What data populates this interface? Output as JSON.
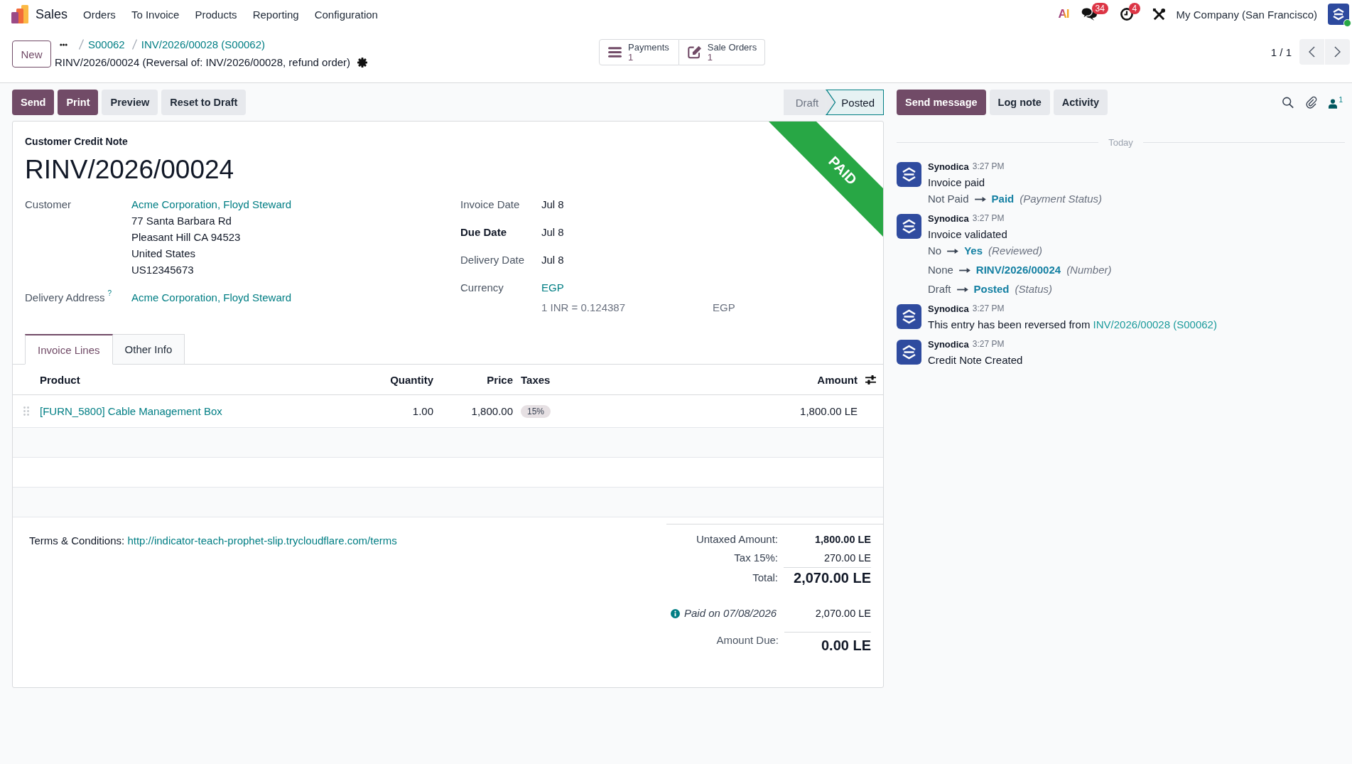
{
  "navbar": {
    "app_name": "Sales",
    "menu": [
      "Orders",
      "To Invoice",
      "Products",
      "Reporting",
      "Configuration"
    ],
    "systray": [
      {
        "kind": "ai",
        "label": "AI"
      },
      {
        "kind": "messages",
        "badge": "34"
      },
      {
        "kind": "activities",
        "badge": "4"
      },
      {
        "kind": "debug"
      }
    ],
    "company": "My Company (San Francisco)",
    "user_online": true
  },
  "control_panel": {
    "new_button": "New",
    "breadcrumbs": [
      "S00062",
      "INV/2026/00028 (S00062)"
    ],
    "record_title": "RINV/2026/00024 (Reversal of: INV/2026/00028, refund order)",
    "smart_buttons": [
      {
        "kind": "payments",
        "label": "Payments",
        "count": "1"
      },
      {
        "kind": "sale_orders",
        "label": "Sale Orders",
        "count": "1"
      }
    ],
    "pager": "1 / 1"
  },
  "actions": [
    {
      "label": "Send",
      "primary": true
    },
    {
      "label": "Print",
      "primary": true
    },
    {
      "label": "Preview",
      "primary": false
    },
    {
      "label": "Reset to Draft",
      "primary": false
    }
  ],
  "statusbar": [
    {
      "label": "Draft",
      "selected": false
    },
    {
      "label": "Posted",
      "selected": true
    }
  ],
  "sheet": {
    "ribbon": "PAID",
    "doc_type": "Customer Credit Note",
    "number": "RINV/2026/00024",
    "left_fields": [
      {
        "label": "Customer",
        "value": "Acme Corporation, Floyd Steward",
        "lines": [
          "77 Santa Barbara Rd",
          "Pleasant Hill CA 94523",
          "United States",
          "US12345673"
        ]
      },
      {
        "label": "Delivery Address",
        "help": "?",
        "value": "Acme Corporation, Floyd Steward"
      }
    ],
    "right_fields": [
      {
        "label": "Invoice Date",
        "value": "Jul 8",
        "bold": false,
        "kind": "text"
      },
      {
        "label": "Due Date",
        "value": "Jul 8",
        "bold": true,
        "kind": "text"
      },
      {
        "label": "Delivery Date",
        "value": "Jul 8",
        "bold": false,
        "kind": "text"
      },
      {
        "label": "Currency",
        "value": "EGP",
        "bold": false,
        "kind": "link"
      }
    ],
    "rate": {
      "text": "1 INR = 0.124387",
      "currency": "EGP"
    },
    "tabs": [
      {
        "label": "Invoice Lines",
        "selected": true
      },
      {
        "label": "Other Info",
        "selected": false
      }
    ],
    "table": {
      "columns": [
        "Product",
        "Quantity",
        "Price",
        "Taxes",
        "Amount"
      ],
      "rows": [
        {
          "product": "[FURN_5800] Cable Management Box",
          "quantity": "1.00",
          "price": "1,800.00",
          "taxes": [
            "15%"
          ],
          "amount": "1,800.00 LE"
        }
      ]
    },
    "terms": {
      "label": "Terms & Conditions:",
      "link": "http://indicator-teach-prophet-slip.trycloudflare.com/terms"
    },
    "totals": [
      {
        "kind": "subtotal",
        "label": "Untaxed Amount:",
        "value": "1,800.00 LE"
      },
      {
        "kind": "tax",
        "label": "Tax 15%:",
        "value": "270.00 LE"
      },
      {
        "kind": "total",
        "label": "Total:",
        "value": "2,070.00 LE"
      }
    ],
    "payments": [
      {
        "label": "Paid on 07/08/2026",
        "value": "2,070.00 LE"
      }
    ],
    "amount_due": {
      "label": "Amount Due:",
      "value": "0.00 LE"
    }
  },
  "chatter": {
    "buttons": [
      {
        "label": "Send message",
        "primary": true
      },
      {
        "label": "Log note",
        "primary": false
      },
      {
        "label": "Activity",
        "primary": false
      }
    ],
    "followers": "1",
    "date_divider": "Today",
    "messages": [
      {
        "author": "Synodica",
        "time": "3:27 PM",
        "body": "Invoice paid",
        "tracking": [
          {
            "old": "Not Paid",
            "new": "Paid",
            "field": "(Payment Status)"
          }
        ]
      },
      {
        "author": "Synodica",
        "time": "3:27 PM",
        "body": "Invoice validated",
        "tracking": [
          {
            "old": "No",
            "new": "Yes",
            "field": "(Reviewed)"
          },
          {
            "old": "None",
            "new": "RINV/2026/00024",
            "field": "(Number)"
          },
          {
            "old": "Draft",
            "new": "Posted",
            "field": "(Status)"
          }
        ]
      },
      {
        "author": "Synodica",
        "time": "3:27 PM",
        "body": "This entry has been reversed from",
        "link": "INV/2026/00028 (S00062)"
      },
      {
        "author": "Synodica",
        "time": "3:27 PM",
        "body": "Credit Note Created"
      }
    ]
  }
}
